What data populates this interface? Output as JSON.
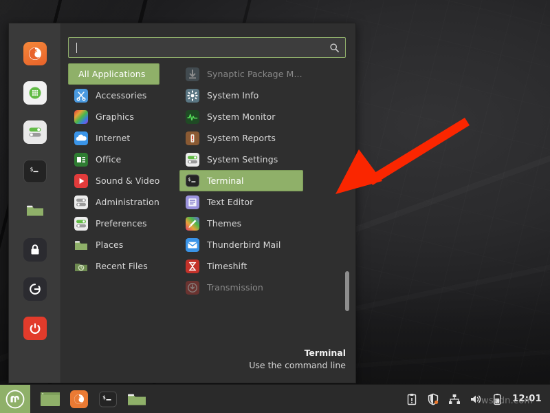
{
  "desktop": {
    "name": "Linux Mint Cinnamon desktop"
  },
  "menu": {
    "search": {
      "value": "",
      "placeholder": "",
      "icon": "search-icon"
    },
    "favorites": [
      {
        "name": "firefox-icon",
        "label": "Firefox Web Browser"
      },
      {
        "name": "software-manager-icon",
        "label": "Software Manager"
      },
      {
        "name": "system-settings-icon",
        "label": "System Settings"
      },
      {
        "name": "terminal-icon",
        "label": "Terminal"
      },
      {
        "name": "files-icon",
        "label": "Files"
      },
      {
        "name": "lock-screen-icon",
        "label": "Lock Screen"
      },
      {
        "name": "logout-icon",
        "label": "Log Out"
      },
      {
        "name": "power-icon",
        "label": "Quit"
      }
    ],
    "categories": [
      {
        "label": "All Applications",
        "icon": "all-applications-icon",
        "selected": true
      },
      {
        "label": "Accessories",
        "icon": "accessories-icon",
        "selected": false
      },
      {
        "label": "Graphics",
        "icon": "graphics-icon",
        "selected": false
      },
      {
        "label": "Internet",
        "icon": "internet-icon",
        "selected": false
      },
      {
        "label": "Office",
        "icon": "office-icon",
        "selected": false
      },
      {
        "label": "Sound & Video",
        "icon": "sound-video-icon",
        "selected": false
      },
      {
        "label": "Administration",
        "icon": "administration-icon",
        "selected": false
      },
      {
        "label": "Preferences",
        "icon": "preferences-icon",
        "selected": false
      },
      {
        "label": "Places",
        "icon": "places-icon",
        "selected": false
      },
      {
        "label": "Recent Files",
        "icon": "recent-files-icon",
        "selected": false
      }
    ],
    "applications": [
      {
        "label": "Synaptic Package M...",
        "icon": "synaptic-icon",
        "selected": false,
        "dim": true
      },
      {
        "label": "System Info",
        "icon": "system-info-icon",
        "selected": false,
        "dim": false
      },
      {
        "label": "System Monitor",
        "icon": "system-monitor-icon",
        "selected": false,
        "dim": false
      },
      {
        "label": "System Reports",
        "icon": "system-reports-icon",
        "selected": false,
        "dim": false
      },
      {
        "label": "System Settings",
        "icon": "system-settings-icon",
        "selected": false,
        "dim": false
      },
      {
        "label": "Terminal",
        "icon": "terminal-icon",
        "selected": true,
        "dim": false
      },
      {
        "label": "Text Editor",
        "icon": "text-editor-icon",
        "selected": false,
        "dim": false
      },
      {
        "label": "Themes",
        "icon": "themes-icon",
        "selected": false,
        "dim": false
      },
      {
        "label": "Thunderbird Mail",
        "icon": "thunderbird-icon",
        "selected": false,
        "dim": false
      },
      {
        "label": "Timeshift",
        "icon": "timeshift-icon",
        "selected": false,
        "dim": false
      },
      {
        "label": "Transmission",
        "icon": "transmission-icon",
        "selected": false,
        "dim": true
      }
    ],
    "status": {
      "title": "Terminal",
      "description": "Use the command line"
    }
  },
  "taskbar": {
    "menu_button": {
      "name": "mint-menu-button",
      "label": "Menu"
    },
    "launchers": [
      {
        "name": "show-desktop-icon",
        "label": "Show Desktop"
      },
      {
        "name": "firefox-icon",
        "label": "Firefox Web Browser"
      },
      {
        "name": "terminal-icon",
        "label": "Terminal"
      },
      {
        "name": "files-icon",
        "label": "Files"
      }
    ],
    "tray": [
      {
        "name": "clipboard-icon",
        "label": "Clipboard"
      },
      {
        "name": "update-manager-shield-icon",
        "label": "Update Manager"
      },
      {
        "name": "network-icon",
        "label": "Network"
      },
      {
        "name": "volume-icon",
        "label": "Volume"
      },
      {
        "name": "battery-icon",
        "label": "Battery"
      }
    ],
    "clock": "12:01"
  },
  "annotation": {
    "arrow": "red-arrow-pointing-to-terminal"
  },
  "watermark": {
    "text": "wsxdn.com"
  },
  "colors": {
    "accent_green": "#8fb069",
    "panel_bg": "#2f2f2f",
    "rail_bg": "#3a3a3a",
    "taskbar_bg": "#2a2a2a",
    "arrow_red": "#fa2600"
  }
}
